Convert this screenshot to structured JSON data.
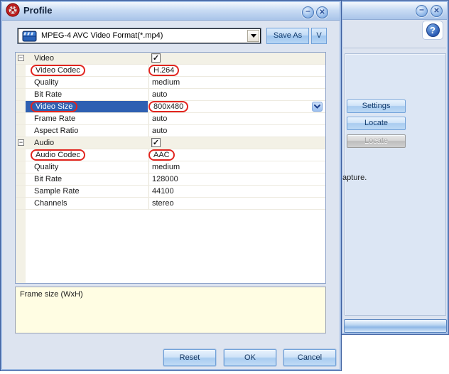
{
  "colors": {
    "annotation_red": "#e2251f",
    "selection_blue": "#2e60b2",
    "description_yellow": "#fffde3",
    "titlebar_blue": "#a9c4e9",
    "button_blue": "#9fc6ef"
  },
  "dialog": {
    "title": "Profile",
    "minimize_glyph": "–",
    "close_glyph": "✕",
    "format": {
      "selected": "MPEG-4 AVC Video Format(*.mp4)",
      "save_as_label": "Save As",
      "v_label": "V"
    },
    "grid": {
      "rows": [
        {
          "label": "Video",
          "value": "",
          "type": "category",
          "checked": true,
          "check_glyph": "✓"
        },
        {
          "label": "Video Codec",
          "value": "H.264",
          "annotated": true
        },
        {
          "label": "Quality",
          "value": "medium"
        },
        {
          "label": "Bit Rate",
          "value": "auto"
        },
        {
          "label": "Video Size",
          "value": "800x480",
          "annotated": true,
          "selected": true,
          "has_dropdown": true
        },
        {
          "label": "Frame Rate",
          "value": "auto"
        },
        {
          "label": "Aspect Ratio",
          "value": "auto"
        },
        {
          "label": "Audio",
          "value": "",
          "type": "category",
          "checked": true,
          "check_glyph": "✓"
        },
        {
          "label": "Audio Codec",
          "value": "AAC",
          "annotated": true
        },
        {
          "label": "Quality",
          "value": "medium"
        },
        {
          "label": "Bit Rate",
          "value": "128000"
        },
        {
          "label": "Sample Rate",
          "value": "44100"
        },
        {
          "label": "Channels",
          "value": "stereo"
        }
      ],
      "collapse_glyph": "−"
    },
    "description": "Frame size (WxH)",
    "buttons": {
      "reset": "Reset",
      "ok": "OK",
      "cancel": "Cancel"
    }
  },
  "background_window": {
    "minimize_glyph": "–",
    "close_glyph": "✕",
    "help_glyph": "?",
    "buttons": {
      "settings": "Settings",
      "locate": "Locate",
      "locate_disabled": "Locate"
    },
    "partial_text": "apture."
  }
}
